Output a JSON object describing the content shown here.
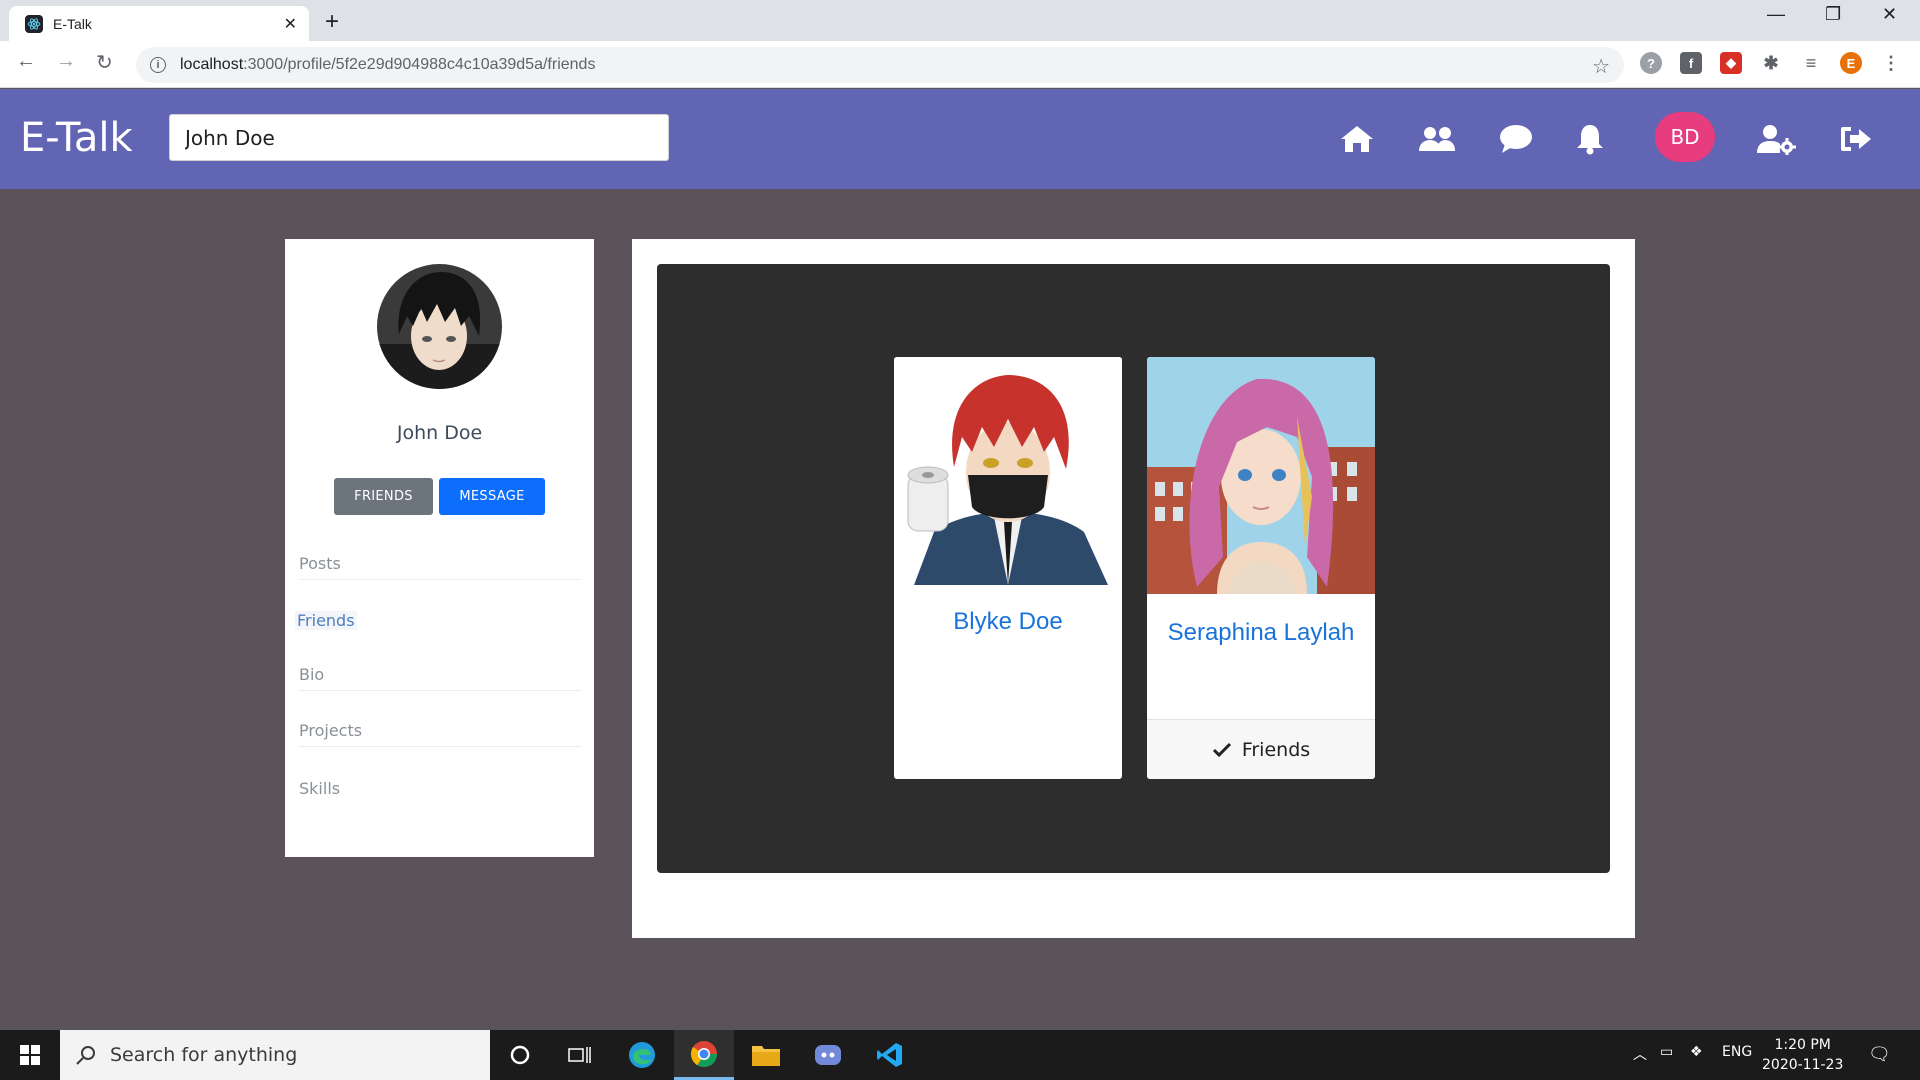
{
  "browser": {
    "tab_title": "E-Talk",
    "url_host": "localhost",
    "url_rest": ":3000/profile/5f2e29d904988c4c10a39d5a/friends",
    "profile_initial": "E"
  },
  "app": {
    "brand": "E-Talk",
    "search_value": "John Doe",
    "user_initials": "BD",
    "nav_icons": [
      "home-icon",
      "friends-icon",
      "chat-icon",
      "bell-icon",
      "user-settings-icon",
      "logout-icon"
    ],
    "accent": "#6265b4",
    "avatar_color": "#e73c7e"
  },
  "profile": {
    "name": "John Doe",
    "friends_button": "FRIENDS",
    "message_button": "MESSAGE",
    "links": [
      "Posts",
      "Friends",
      "Bio",
      "Projects",
      "Skills"
    ],
    "active_link": "Friends"
  },
  "friends": [
    {
      "name": "Blyke Doe",
      "status": ""
    },
    {
      "name": "Seraphina Laylah",
      "status": "Friends"
    }
  ],
  "taskbar": {
    "search_placeholder": "Search for anything",
    "lang": "ENG",
    "time": "1:20 PM",
    "date": "2020-11-23"
  }
}
